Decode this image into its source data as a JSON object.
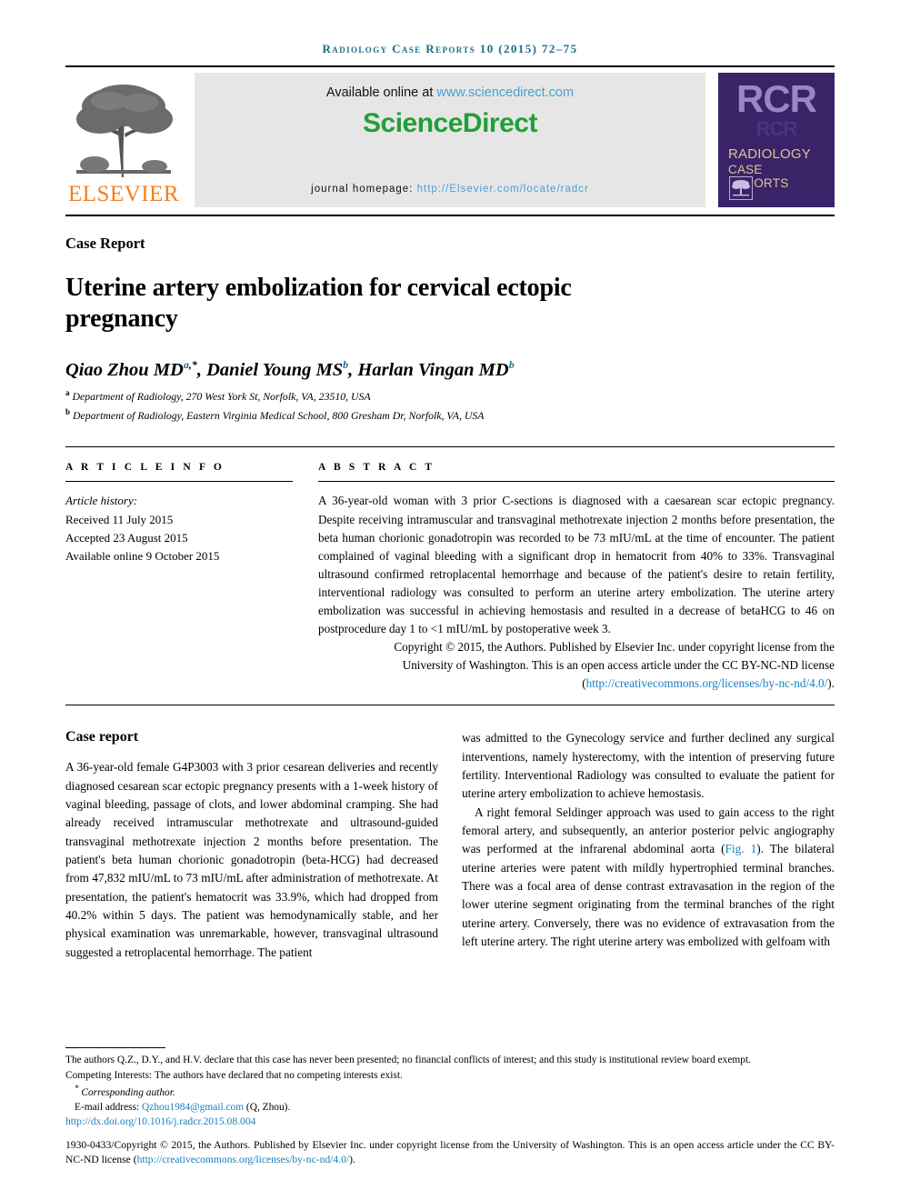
{
  "running_head": "Radiology Case Reports 10 (2015) 72–75",
  "masthead": {
    "elsevier_wordmark": "ELSEVIER",
    "available_online_prefix": "Available online at ",
    "sciencedirect_url": "www.sciencedirect.com",
    "sciencedirect_logo": "ScienceDirect",
    "journal_homepage_label": "journal homepage: ",
    "journal_homepage_url": "http://Elsevier.com/locate/radcr",
    "cover": {
      "acronym": "RCR",
      "line1": "RADIOLOGY",
      "line2": "CASE",
      "line3": "REPORTS"
    }
  },
  "article": {
    "type_label": "Case Report",
    "title": "Uterine artery embolization for cervical ectopic pregnancy",
    "authors": [
      {
        "name": "Qiao Zhou MD",
        "sup": "a",
        "star": true
      },
      {
        "name": "Daniel Young MS",
        "sup": "b",
        "star": false
      },
      {
        "name": "Harlan Vingan MD",
        "sup": "b",
        "star": false
      }
    ],
    "affiliations": [
      {
        "marker": "a",
        "text": "Department of Radiology, 270 West York St, Norfolk, VA, 23510, USA"
      },
      {
        "marker": "b",
        "text": "Department of Radiology, Eastern Virginia Medical School, 800 Gresham Dr, Norfolk, VA, USA"
      }
    ]
  },
  "article_info": {
    "heading": "A R T I C L E   I N F O",
    "history_label": "Article history:",
    "received": "Received 11 July 2015",
    "accepted": "Accepted 23 August 2015",
    "available_online": "Available online 9 October 2015"
  },
  "abstract": {
    "heading": "A B S T R A C T",
    "body": "A 36-year-old woman with 3 prior C-sections is diagnosed with a caesarean scar ectopic pregnancy. Despite receiving intramuscular and transvaginal methotrexate injection 2 months before presentation, the beta human chorionic gonadotropin was recorded to be 73 mIU/mL at the time of encounter. The patient complained of vaginal bleeding with a significant drop in hematocrit from 40% to 33%. Transvaginal ultrasound confirmed retroplacental hemorrhage and because of the patient's desire to retain fertility, interventional radiology was consulted to perform an uterine artery embolization. The uterine artery embolization was successful in achieving hemostasis and resulted in a decrease of betaHCG to 46 on postprocedure day 1 to <1 mIU/mL by postoperative week 3.",
    "copyright_line1": "Copyright © 2015, the Authors. Published by Elsevier Inc. under copyright license from the",
    "copyright_line2": "University of Washington. This is an open access article under the CC BY-NC-ND license",
    "copyright_link_open": "(",
    "copyright_link": "http://creativecommons.org/licenses/by-nc-nd/4.0/",
    "copyright_link_close": ")."
  },
  "body": {
    "section_heading": "Case report",
    "left_paragraph": "A 36-year-old female G4P3003 with 3 prior cesarean deliveries and recently diagnosed cesarean scar ectopic pregnancy presents with a 1-week history of vaginal bleeding, passage of clots, and lower abdominal cramping. She had already received intramuscular methotrexate and ultrasound-guided transvaginal methotrexate injection 2 months before presentation. The patient's beta human chorionic gonadotropin (beta-HCG) had decreased from 47,832 mIU/mL to 73 mIU/mL after administration of methotrexate. At presentation, the patient's hematocrit was 33.9%, which had dropped from 40.2% within 5 days. The patient was hemodynamically stable, and her physical examination was unremarkable, however, transvaginal ultrasound suggested a retroplacental hemorrhage. The patient",
    "right_paragraph_1": "was admitted to the Gynecology service and further declined any surgical interventions, namely hysterectomy, with the intention of preserving future fertility. Interventional Radiology was consulted to evaluate the patient for uterine artery embolization to achieve hemostasis.",
    "right_paragraph_2_before": "A right femoral Seldinger approach was used to gain access to the right femoral artery, and subsequently, an anterior posterior pelvic angiography was performed at the infrarenal abdominal aorta (",
    "right_paragraph_2_link": "Fig. 1",
    "right_paragraph_2_after": "). The bilateral uterine arteries were patent with mildly hypertrophied terminal branches. There was a focal area of dense contrast extravasation in the region of the lower uterine segment originating from the terminal branches of the right uterine artery. Conversely, there was no evidence of extravasation from the left uterine artery. The right uterine artery was embolized with gelfoam with"
  },
  "footnotes": {
    "declaration": "The authors Q.Z., D.Y., and H.V. declare that this case has never been presented; no financial conflicts of interest; and this study is institutional review board exempt.",
    "competing_interests": "Competing Interests: The authors have declared that no competing interests exist.",
    "corresponding_author": "Corresponding author.",
    "email_label": "E-mail address: ",
    "email": "Qzhou1984@gmail.com",
    "email_suffix": " (Q, Zhou).",
    "doi": "http://dx.doi.org/10.1016/j.radcr.2015.08.004",
    "issn_copyright_before": "1930-0433/Copyright © 2015, the Authors. Published by Elsevier Inc. under copyright license from the University of Washington. This is an open access article under the CC BY-NC-ND license (",
    "issn_copyright_link": "http://creativecommons.org/licenses/by-nc-nd/4.0/",
    "issn_copyright_after": ")."
  },
  "colors": {
    "running_head": "#1a6e8e",
    "link": "#1a7fbf",
    "sciencedirect_green": "#20a038",
    "elsevier_orange": "#f57f20",
    "cover_purple": "#3b2368",
    "cover_gold": "#d8c98f"
  }
}
